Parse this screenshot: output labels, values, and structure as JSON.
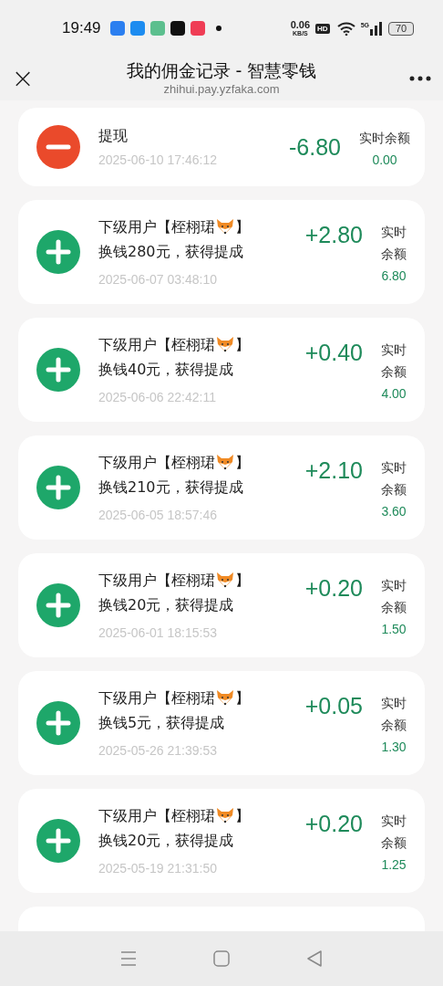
{
  "status_bar": {
    "time": "19:49",
    "speed": "0.06",
    "speed_unit": "KB/S",
    "hd": "HD",
    "network": "5G",
    "battery": "70",
    "app_icons": [
      {
        "color": "#2b7ff0"
      },
      {
        "color": "#1d8cf0"
      },
      {
        "color": "#5cbf8e"
      },
      {
        "color": "#111111"
      },
      {
        "color": "#ef3d55"
      }
    ]
  },
  "header": {
    "close": "×",
    "title": "我的佣金记录 - 智慧零钱",
    "url": "zhihui.pay.yzfaka.com"
  },
  "records": [
    {
      "kind": "withdraw",
      "title": "提现",
      "time": "2025-06-10 17:46:12",
      "amount": "-6.80",
      "balance_label": "实时余额",
      "balance": "0.00"
    },
    {
      "kind": "commission",
      "title_before": "下级用户【桎栩珺",
      "title_after": "】",
      "description": "换钱280元，获得提成",
      "time": "2025-06-07 03:48:10",
      "amount": "+2.80",
      "balance_label": "实时余额",
      "balance": "6.80"
    },
    {
      "kind": "commission",
      "title_before": "下级用户【桎栩珺",
      "title_after": "】",
      "description": "换钱40元，获得提成",
      "time": "2025-06-06 22:42:11",
      "amount": "+0.40",
      "balance_label": "实时余额",
      "balance": "4.00"
    },
    {
      "kind": "commission",
      "title_before": "下级用户【桎栩珺",
      "title_after": "】",
      "description": "换钱210元，获得提成",
      "time": "2025-06-05 18:57:46",
      "amount": "+2.10",
      "balance_label": "实时余额",
      "balance": "3.60"
    },
    {
      "kind": "commission",
      "title_before": "下级用户【桎栩珺",
      "title_after": "】",
      "description": "换钱20元，获得提成",
      "time": "2025-06-01 18:15:53",
      "amount": "+0.20",
      "balance_label": "实时余额",
      "balance": "1.50"
    },
    {
      "kind": "commission",
      "title_before": "下级用户【桎栩珺",
      "title_after": "】",
      "description": "换钱5元，获得提成",
      "time": "2025-05-26 21:39:53",
      "amount": "+0.05",
      "balance_label": "实时余额",
      "balance": "1.30"
    },
    {
      "kind": "commission",
      "title_before": "下级用户【桎栩珺",
      "title_after": "】",
      "description": "换钱20元，获得提成",
      "time": "2025-05-19 21:31:50",
      "amount": "+0.20",
      "balance_label": "实时余额",
      "balance": "1.25"
    }
  ]
}
